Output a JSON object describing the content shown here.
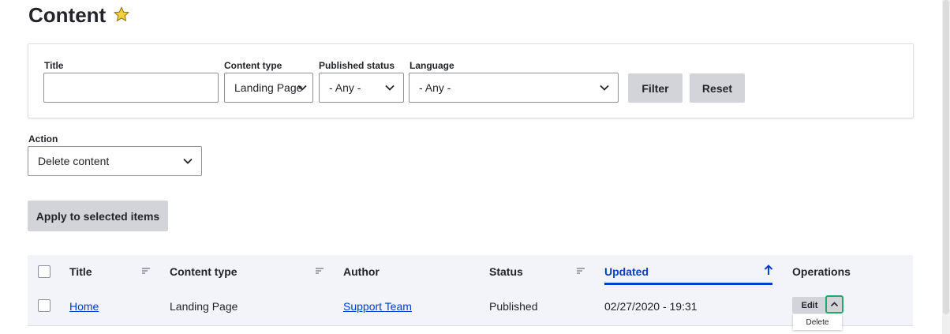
{
  "page": {
    "title": "Content",
    "star": "☆"
  },
  "filters": {
    "title_label": "Title",
    "title_value": "",
    "content_type_label": "Content type",
    "content_type_value": "Landing Page",
    "published_label": "Published status",
    "published_value": "- Any -",
    "language_label": "Language",
    "language_value": "- Any -",
    "filter_button": "Filter",
    "reset_button": "Reset"
  },
  "bulk": {
    "action_label": "Action",
    "action_value": "Delete content",
    "apply_button": "Apply to selected items"
  },
  "table": {
    "headers": {
      "title": "Title",
      "content_type": "Content type",
      "author": "Author",
      "status": "Status",
      "updated": "Updated",
      "operations": "Operations"
    },
    "rows": [
      {
        "title": "Home",
        "content_type": "Landing Page",
        "author": "Support Team",
        "status": "Published",
        "updated": "02/27/2020 - 19:31",
        "edit": "Edit",
        "delete": "Delete"
      }
    ]
  },
  "colors": {
    "accent": "#003ecc",
    "focus": "#26a769",
    "button": "#d3d4d9",
    "table_bg": "#f3f4f9"
  }
}
